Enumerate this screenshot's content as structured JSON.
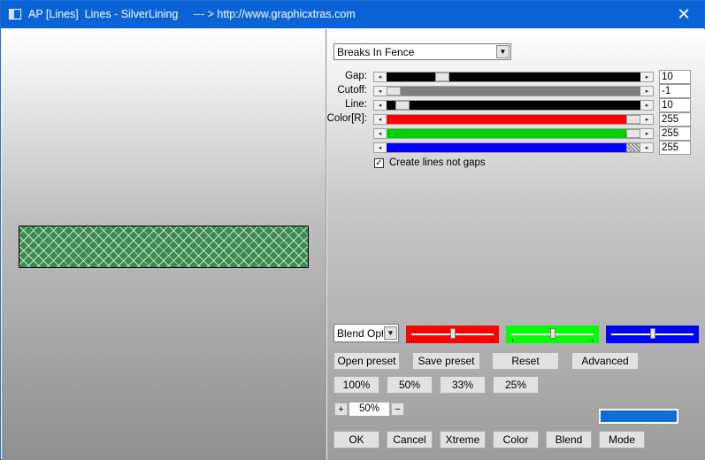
{
  "window": {
    "title": "AP [Lines]  Lines - SilverLining     --- > http://www.graphicxtras.com",
    "close_label": "✕"
  },
  "effect_select": {
    "value": "Breaks In Fence"
  },
  "sliders": [
    {
      "label": "Gap:",
      "value": "10",
      "level": 0.22,
      "track_color": "#000000"
    },
    {
      "label": "Cutoff:",
      "value": "-1",
      "level": 0.0,
      "track_color": "#7f7f7f"
    },
    {
      "label": "Line:",
      "value": "10",
      "level": 0.02,
      "track_color": "#000000"
    },
    {
      "label": "Color[R]:",
      "value": "255",
      "level": 1.0,
      "track_color": "#ff0000"
    },
    {
      "label": "",
      "value": "255",
      "level": 1.0,
      "track_color": "#00d000"
    },
    {
      "label": "",
      "value": "255",
      "level": 1.0,
      "track_color": "#0000ff"
    }
  ],
  "create_lines_checkbox": {
    "label": "Create lines not gaps",
    "checked": true,
    "mark": "✓"
  },
  "blend_select": {
    "value": "Blend Option"
  },
  "color_swatches": [
    {
      "name": "red",
      "color": "#ff0000",
      "level": 0.5
    },
    {
      "name": "green",
      "color": "#00ff00",
      "level": 0.5
    },
    {
      "name": "blue",
      "color": "#0000ff",
      "level": 0.5
    }
  ],
  "preset_buttons": {
    "open": "Open preset",
    "save": "Save preset",
    "reset": "Reset",
    "advanced": "Advanced"
  },
  "zoom_buttons": [
    "100%",
    "50%",
    "33%",
    "25%"
  ],
  "zoom": {
    "plus": "+",
    "value": "50%",
    "minus": "−"
  },
  "blend_color": "#0a6fd0",
  "bottom_buttons": {
    "ok": "OK",
    "cancel": "Cancel",
    "xtreme": "Xtreme",
    "color": "Color",
    "blend": "Blend",
    "mode": "Mode"
  }
}
